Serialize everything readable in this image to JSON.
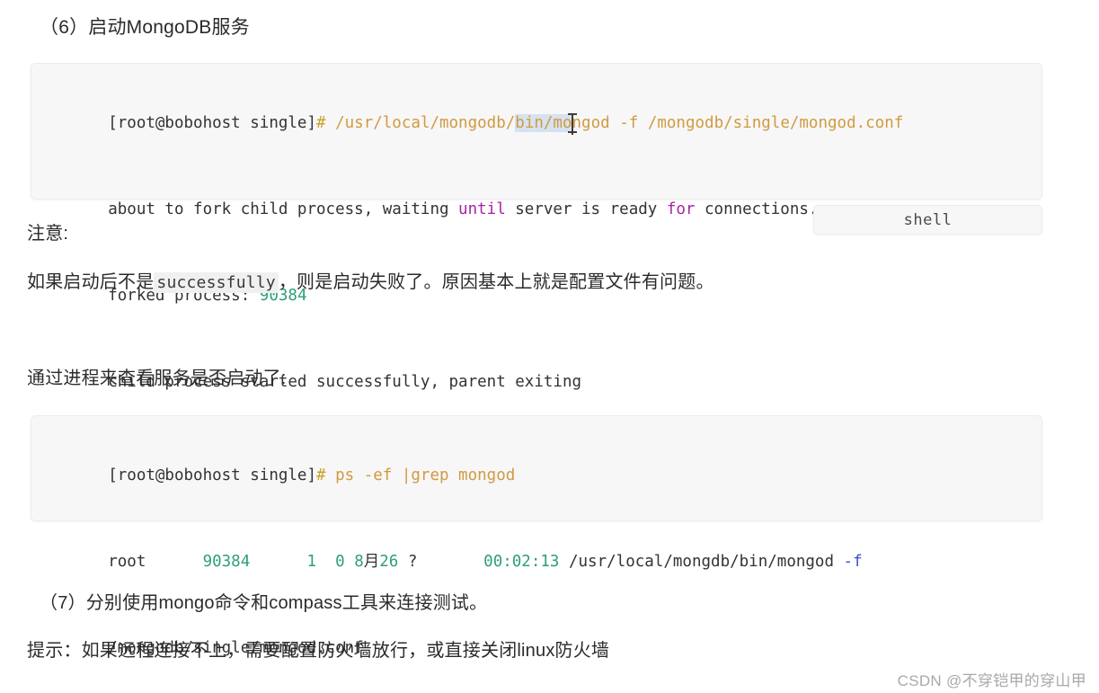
{
  "document": {
    "section_heading": "（6）启动MongoDB服务",
    "note_label": "注意:",
    "note_text_before": "如果启动后不是",
    "note_inline_code": "successfully",
    "note_text_after": "，则是启动失败了。原因基本上就是配置文件有问题。",
    "process_check_text": "通过进程来查看服务是否启动了:",
    "section_seven": "（7）分别使用mongo命令和compass工具来连接测试。",
    "tip_text": "提示：如果远程连接不上，需要配置防火墙放行，或直接关闭linux防火墙"
  },
  "code_block_1": {
    "language_label": "shell",
    "lines": [
      {
        "tokens": [
          {
            "text": "[root@bobohost single]",
            "type": "prompt"
          },
          {
            "text": "# ",
            "type": "hash"
          },
          {
            "text": "/usr/local/mongodb/",
            "type": "path"
          },
          {
            "text": "bin/mo",
            "type": "path-selected"
          },
          {
            "text": "ngod",
            "type": "path"
          },
          {
            "text": " -f ",
            "type": "path"
          },
          {
            "text": "/mongodb/single/mongod.conf",
            "type": "path"
          }
        ]
      },
      {
        "tokens": [
          {
            "text": "about to fork child process, waiting ",
            "type": "plain"
          },
          {
            "text": "until",
            "type": "kw"
          },
          {
            "text": " server is ready ",
            "type": "plain"
          },
          {
            "text": "for",
            "type": "kw"
          },
          {
            "text": " connections.",
            "type": "plain"
          }
        ]
      },
      {
        "tokens": [
          {
            "text": "forked process: ",
            "type": "plain"
          },
          {
            "text": "90384",
            "type": "num"
          }
        ]
      },
      {
        "tokens": [
          {
            "text": "child process started successfully, parent exiting",
            "type": "plain"
          }
        ]
      }
    ]
  },
  "code_block_2": {
    "lines": [
      {
        "tokens": [
          {
            "text": "[root@bobohost single]",
            "type": "prompt"
          },
          {
            "text": "# ",
            "type": "hash"
          },
          {
            "text": "ps -ef |grep mongod",
            "type": "cmd"
          }
        ]
      },
      {
        "tokens": [
          {
            "text": "root      ",
            "type": "plain"
          },
          {
            "text": "90384",
            "type": "num"
          },
          {
            "text": "      ",
            "type": "plain"
          },
          {
            "text": "1",
            "type": "num"
          },
          {
            "text": "  ",
            "type": "plain"
          },
          {
            "text": "0",
            "type": "num"
          },
          {
            "text": " ",
            "type": "plain"
          },
          {
            "text": "8",
            "type": "num"
          },
          {
            "text": "月",
            "type": "plain"
          },
          {
            "text": "26",
            "type": "num"
          },
          {
            "text": " ?       ",
            "type": "plain"
          },
          {
            "text": "00:02:13",
            "type": "num"
          },
          {
            "text": " /usr/local/mongdb/bin/mongod ",
            "type": "plain"
          },
          {
            "text": "-f",
            "type": "flag"
          }
        ]
      },
      {
        "tokens": [
          {
            "text": "/mongodb/single/mongod.conf",
            "type": "plain"
          }
        ]
      }
    ]
  },
  "watermark": {
    "text": "CSDN @不穿铠甲的穿山甲"
  },
  "colors": {
    "code_background": "#f7f7f8",
    "code_border": "#ececec",
    "token_path": "#d19a3f",
    "token_keyword": "#a626a4",
    "token_number": "#2f9e79",
    "token_flag": "#4050c8",
    "selection": "#d6e2ef",
    "text": "#2b2b2b",
    "watermark": "#a9a9a9"
  }
}
